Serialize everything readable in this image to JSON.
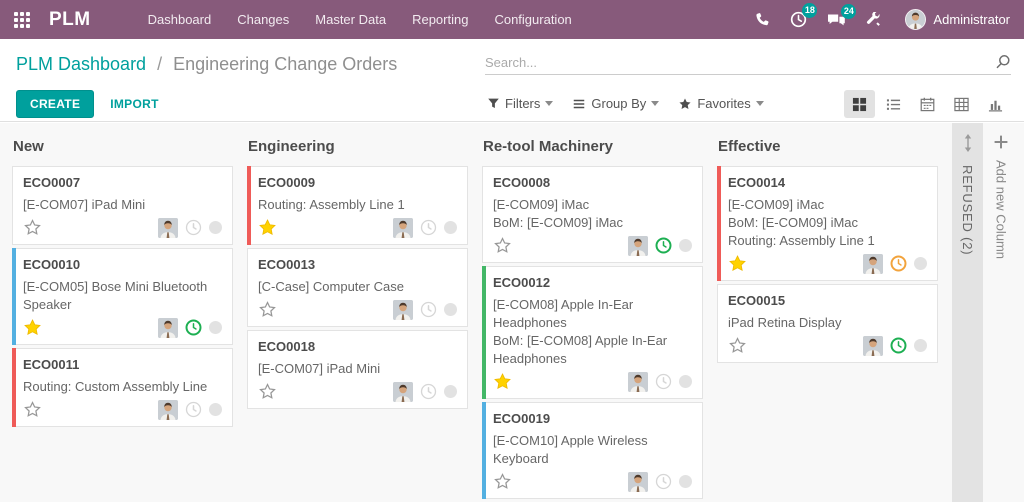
{
  "navbar": {
    "brand": "PLM",
    "menu_items": [
      "Dashboard",
      "Changes",
      "Master Data",
      "Reporting",
      "Configuration"
    ],
    "systray": {
      "icons": [
        "phone-icon",
        "activity-clock-icon",
        "messages-icon",
        "tools-icon"
      ],
      "activities_count": "18",
      "messages_count": "24",
      "user_name": "Administrator"
    }
  },
  "control_panel": {
    "breadcrumb": {
      "parent": "PLM Dashboard",
      "separator": "/",
      "current": "Engineering Change Orders"
    },
    "actions": {
      "create": "CREATE",
      "import": "IMPORT"
    },
    "search": {
      "placeholder": "Search...",
      "icon": "search-icon"
    },
    "filter_menus": [
      {
        "label": "Filters",
        "icon": "filter-icon"
      },
      {
        "label": "Group By",
        "icon": "group-by-icon"
      },
      {
        "label": "Favorites",
        "icon": "favorites-star-icon"
      }
    ],
    "view_switcher": [
      {
        "name": "kanban",
        "active": true
      },
      {
        "name": "list",
        "active": false
      },
      {
        "name": "calendar",
        "active": false
      },
      {
        "name": "pivot",
        "active": false
      },
      {
        "name": "graph",
        "active": false
      }
    ]
  },
  "kanban": {
    "columns": [
      {
        "title": "New",
        "cards": [
          {
            "id": "ECO0007",
            "lines": [
              "[E-COM07] iPad Mini"
            ],
            "starred": false,
            "bar": "none",
            "activity": "idle"
          },
          {
            "id": "ECO0010",
            "lines": [
              "[E-COM05] Bose Mini Bluetooth Speaker"
            ],
            "starred": true,
            "bar": "blue",
            "activity": "green"
          },
          {
            "id": "ECO0011",
            "lines": [
              "Routing: Custom Assembly Line"
            ],
            "starred": false,
            "bar": "red",
            "activity": "idle"
          }
        ]
      },
      {
        "title": "Engineering",
        "cards": [
          {
            "id": "ECO0009",
            "lines": [
              "Routing: Assembly Line 1"
            ],
            "starred": true,
            "bar": "red",
            "activity": "idle"
          },
          {
            "id": "ECO0013",
            "lines": [
              "[C-Case] Computer Case"
            ],
            "starred": false,
            "bar": "none",
            "activity": "idle"
          },
          {
            "id": "ECO0018",
            "lines": [
              "[E-COM07] iPad Mini"
            ],
            "starred": false,
            "bar": "none",
            "activity": "idle"
          }
        ]
      },
      {
        "title": "Re-tool Machinery",
        "cards": [
          {
            "id": "ECO0008",
            "lines": [
              "[E-COM09] iMac",
              "BoM: [E-COM09] iMac"
            ],
            "starred": false,
            "bar": "none",
            "activity": "green"
          },
          {
            "id": "ECO0012",
            "lines": [
              "[E-COM08] Apple In-Ear Headphones",
              "BoM: [E-COM08] Apple In-Ear Headphones"
            ],
            "starred": true,
            "bar": "green",
            "activity": "idle"
          },
          {
            "id": "ECO0019",
            "lines": [
              "[E-COM10] Apple Wireless Keyboard"
            ],
            "starred": false,
            "bar": "blue",
            "activity": "idle"
          }
        ]
      },
      {
        "title": "Effective",
        "cards": [
          {
            "id": "ECO0014",
            "lines": [
              "[E-COM09] iMac",
              "BoM: [E-COM09] iMac",
              "Routing: Assembly Line 1"
            ],
            "starred": true,
            "bar": "red",
            "activity": "orange"
          },
          {
            "id": "ECO0015",
            "lines": [
              "iPad Retina Display"
            ],
            "starred": false,
            "bar": "none",
            "activity": "green"
          }
        ]
      }
    ],
    "folded_column": {
      "title": "REFUSED (2)"
    },
    "add_column_label": "Add new Column"
  },
  "colors": {
    "navbar_bg": "#875a7b",
    "accent_teal": "#00a09d",
    "badge_teal": "#00a09d",
    "star_gold": "#ffd200",
    "star_outline": "#979797",
    "bar_red": "#ef5b58",
    "bar_blue": "#53b0e1",
    "bar_green": "#43b767",
    "activity_green": "#1daf52",
    "activity_orange": "#f2a33c",
    "activity_idle": "#d6d6d6"
  }
}
